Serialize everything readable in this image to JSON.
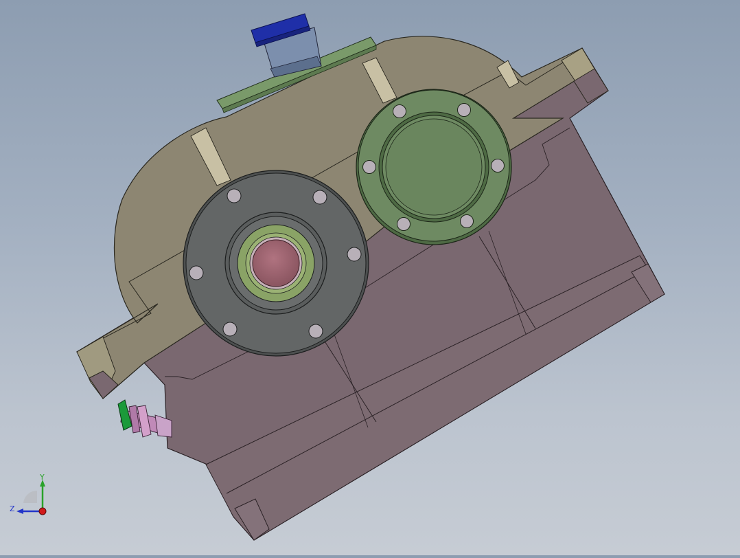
{
  "viewport": {
    "background_top": "#8d9db1",
    "background_bottom": "#c6ccd4"
  },
  "model": {
    "colors": {
      "housing_body": "#7a6870",
      "housing_cover": "#8d8672",
      "input_flange": "#636666",
      "output_cover": "#6e8a62",
      "seal_green": "#8aa366",
      "shaft_end": "#9a5f6a",
      "motor_cap": "#1f2fa8",
      "vent_plate": "#7a9a6a",
      "oil_plug_pink": "#c08ab8",
      "oil_plug_ring": "#1b9a3a"
    }
  },
  "triad": {
    "x_color": "#d11a1a",
    "y_color": "#2aa22a",
    "z_color": "#2235c9",
    "labels": {
      "y": "Y",
      "z": "Z"
    }
  }
}
